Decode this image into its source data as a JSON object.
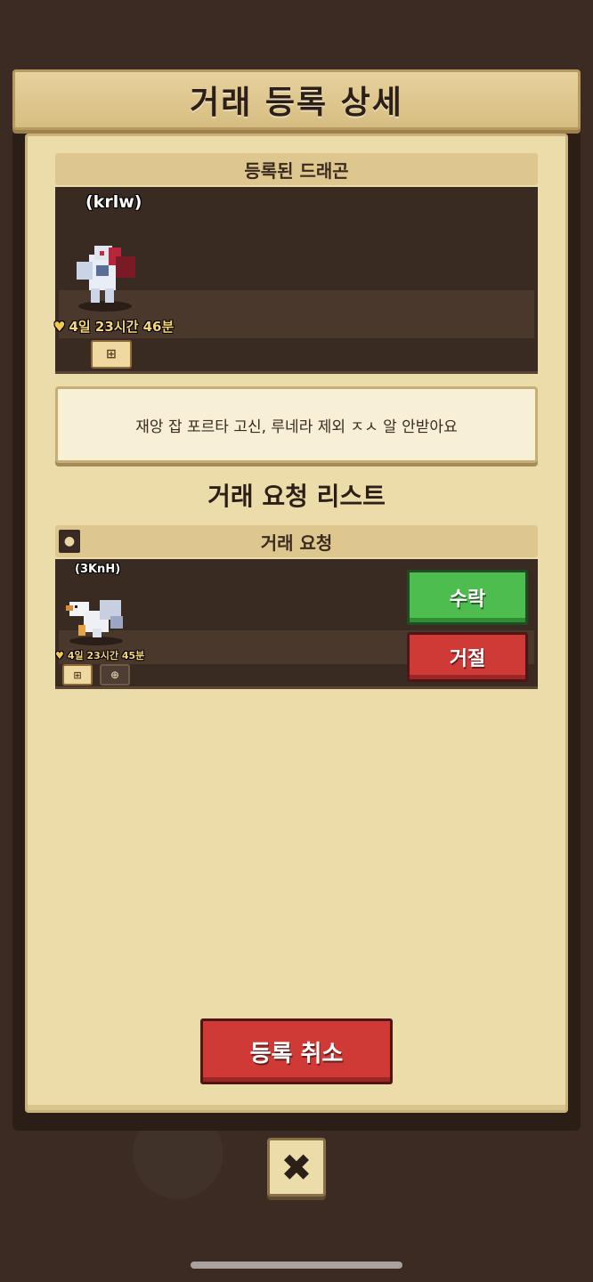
{
  "title": "거래 등록 상세",
  "registered": {
    "header": "등록된 드래곤",
    "dragon_name": "(krlw)",
    "life": "4일 23시간 46분",
    "note": "재앙 잡 포르타 고신, 루네라 제외 ㅈㅅ 알 안받아요"
  },
  "request_list": {
    "title": "거래 요청 리스트",
    "header": "거래 요청",
    "items": [
      {
        "dragon_name": "(3KnH)",
        "life": "4일 23시간 45분",
        "accept_label": "수락",
        "reject_label": "거절"
      }
    ]
  },
  "cancel_label": "등록 취소",
  "close_icon": "✖",
  "colors": {
    "accept": "#4ebd4f",
    "reject": "#cf3a36",
    "panel": "#ebdcaa"
  }
}
